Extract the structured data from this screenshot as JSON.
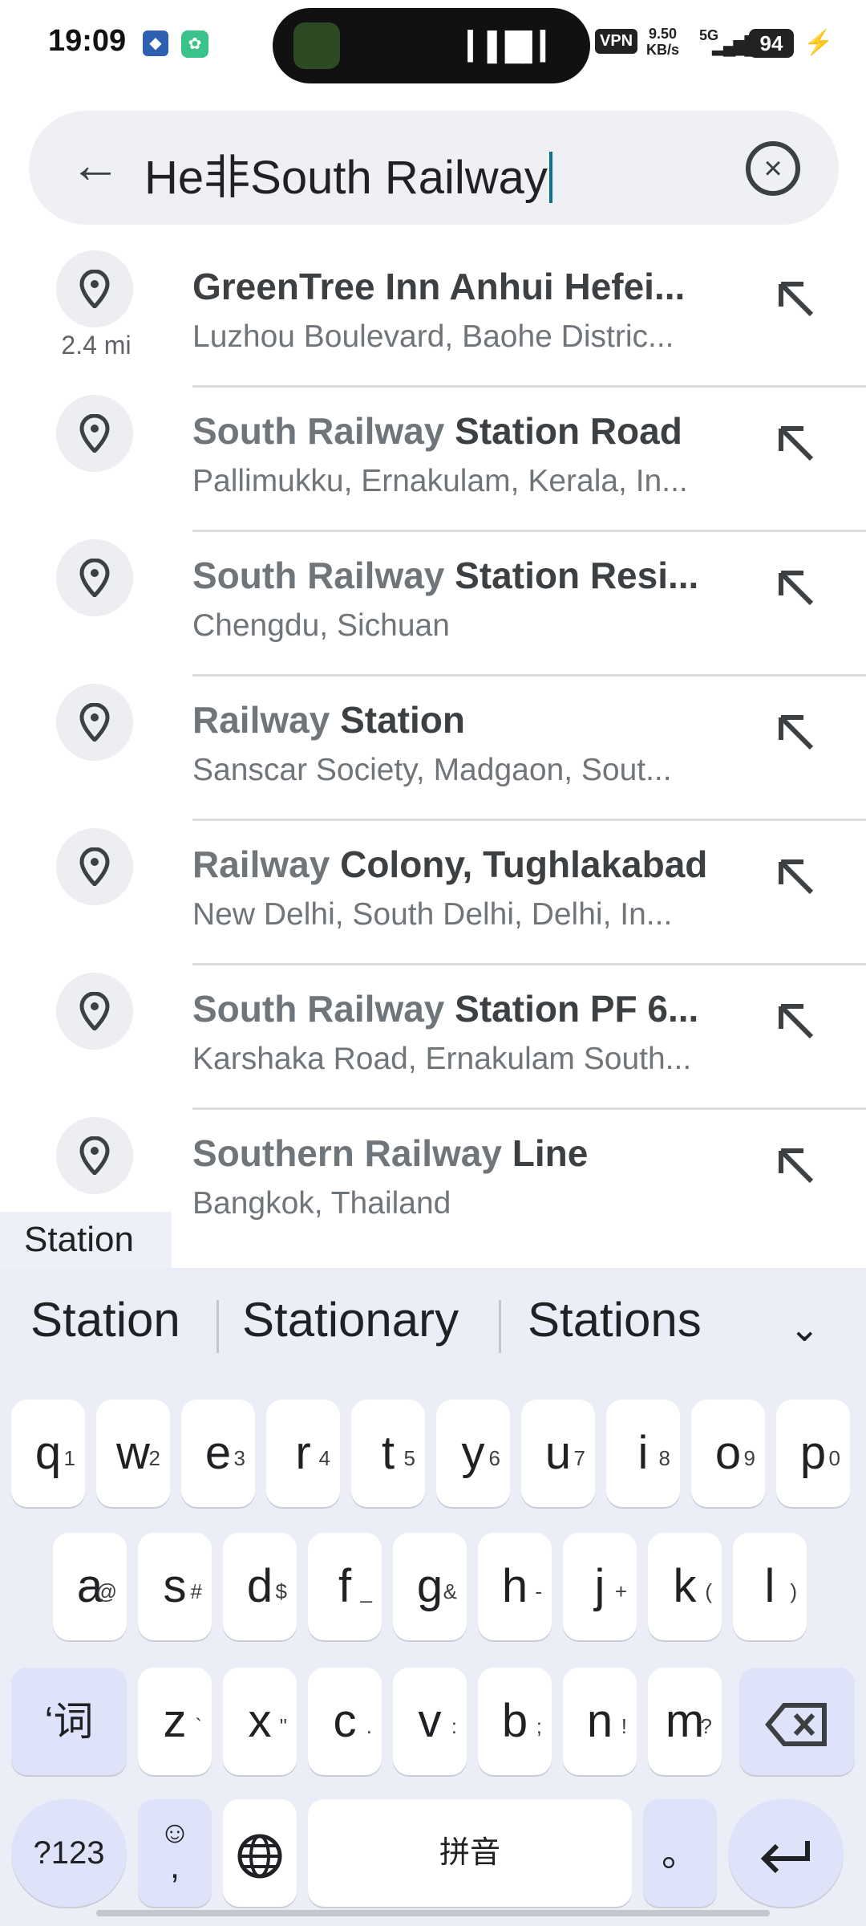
{
  "status_bar": {
    "time": "19:09",
    "vpn": "VPN",
    "speed_top": "9.50",
    "speed_bottom": "KB/s",
    "network": "5G",
    "battery": "94"
  },
  "search": {
    "query": "He非South Railway"
  },
  "results": [
    {
      "highlight": "",
      "title": "GreenTree Inn Anhui Hefei...",
      "subtitle": "Luzhou Boulevard, Baohe Distric...",
      "distance": "2.4 mi"
    },
    {
      "highlight": "South Railway",
      "title": " Station Road",
      "subtitle": "Pallimukku, Ernakulam, Kerala, In...",
      "distance": ""
    },
    {
      "highlight": "South Railway",
      "title": " Station Resi...",
      "subtitle": "Chengdu, Sichuan",
      "distance": ""
    },
    {
      "highlight": "Railway",
      "title": " Station",
      "subtitle": "Sanscar Society, Madgaon, Sout...",
      "distance": ""
    },
    {
      "highlight": "Railway",
      "title": " Colony, Tughlakabad",
      "subtitle": "New Delhi, South Delhi, Delhi, In...",
      "distance": ""
    },
    {
      "highlight": "South Railway",
      "title": " Station PF 6...",
      "subtitle": "Karshaka Road, Ernakulam South...",
      "distance": ""
    },
    {
      "highlight": "Southern Railway",
      "title": " Line",
      "subtitle": "Bangkok, Thailand",
      "distance": ""
    }
  ],
  "chip": "Station",
  "keyboard": {
    "suggestions": [
      "Station",
      "Stationary",
      "Stations"
    ],
    "row1": [
      [
        "q",
        "1"
      ],
      [
        "w",
        "2"
      ],
      [
        "e",
        "3"
      ],
      [
        "r",
        "4"
      ],
      [
        "t",
        "5"
      ],
      [
        "y",
        "6"
      ],
      [
        "u",
        "7"
      ],
      [
        "i",
        "8"
      ],
      [
        "o",
        "9"
      ],
      [
        "p",
        "0"
      ]
    ],
    "row2": [
      [
        "a",
        "@"
      ],
      [
        "s",
        "#"
      ],
      [
        "d",
        "$"
      ],
      [
        "f",
        "_"
      ],
      [
        "g",
        "&"
      ],
      [
        "h",
        "-"
      ],
      [
        "j",
        "+"
      ],
      [
        "k",
        "("
      ],
      [
        "l",
        ")"
      ]
    ],
    "row3": [
      [
        "z",
        "`"
      ],
      [
        "x",
        "\""
      ],
      [
        "c",
        "."
      ],
      [
        "v",
        ":"
      ],
      [
        "b",
        ";"
      ],
      [
        "n",
        "!"
      ],
      [
        "m",
        "?"
      ]
    ],
    "pinyin_toggle": "‘词",
    "symbols": "?123",
    "emoji": "☺",
    "comma": ",",
    "space": "拼音",
    "period": "。"
  }
}
